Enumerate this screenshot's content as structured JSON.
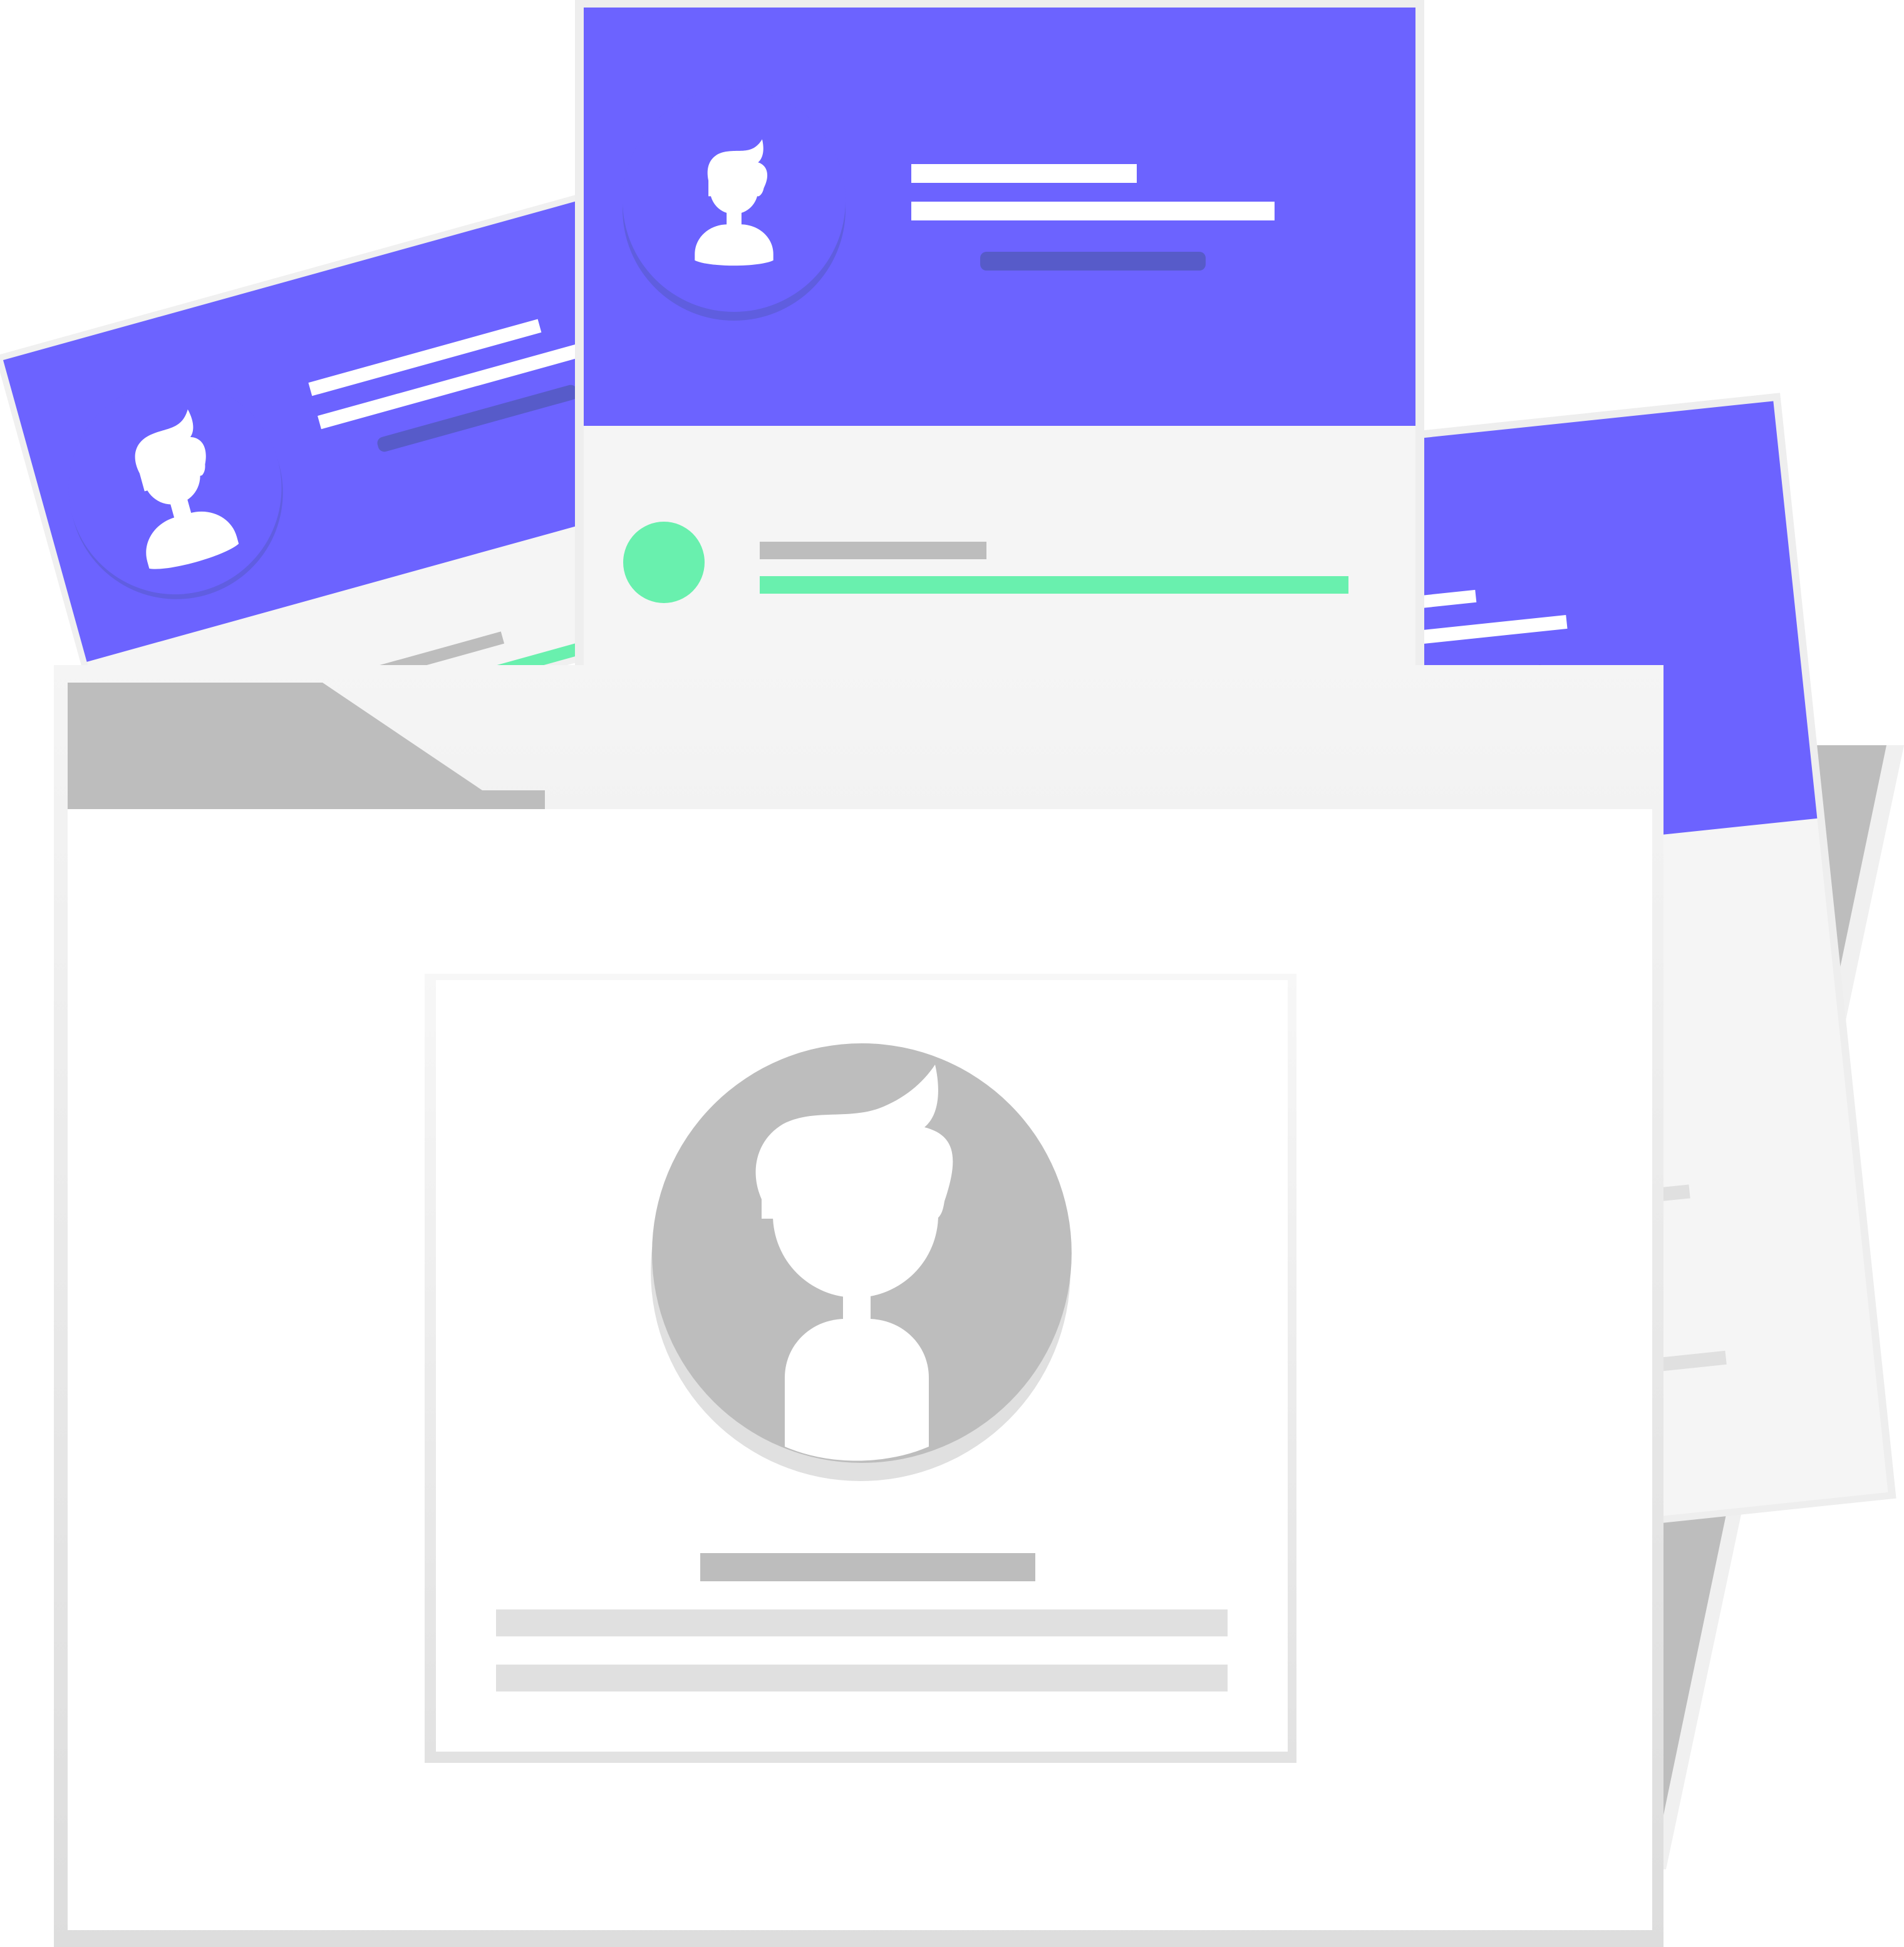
{
  "illustration": {
    "subject": "profile-cards-in-folder",
    "colors": {
      "accent": "#6c63ff",
      "accent_shadow": "#575bc9",
      "success": "#69f0ae",
      "placeholder_dark": "#bdbdbd",
      "placeholder_light": "#e0e0e0",
      "card_body": "#f5f5f5",
      "card_border": "#eeeeee",
      "folder_back": "#bdbdbd",
      "folder_front": "#ffffff",
      "avatar_figure": "#ffffff"
    },
    "icons": [
      "user-avatar-icon",
      "status-dot-icon",
      "folder-icon"
    ]
  }
}
